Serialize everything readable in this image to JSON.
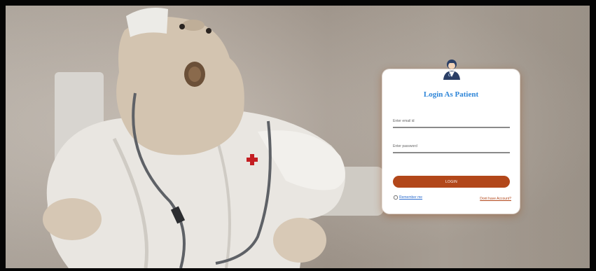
{
  "login_card": {
    "title": "Login As Patient",
    "email_placeholder": "Enter email id",
    "password_placeholder": "Enter password",
    "login_button": "LOGIN",
    "remember_label": "Remember me",
    "signup_link": "Dont have Account?"
  },
  "background": {
    "image": "plush hippo dressed as a doctor with stethoscope, sitting on a white chair"
  },
  "colors": {
    "accent_button": "#b2471a",
    "title_blue": "#2f86d8",
    "frame": "#050505"
  },
  "icons": [
    "doctor-avatar-icon",
    "red-cross-icon",
    "stethoscope-icon"
  ]
}
